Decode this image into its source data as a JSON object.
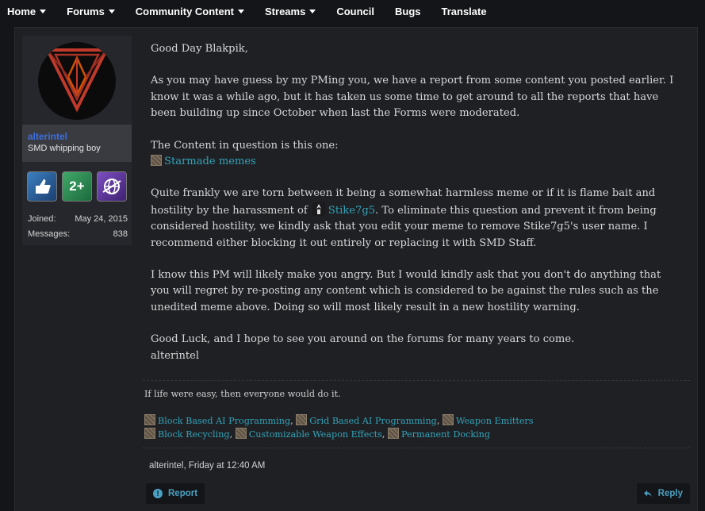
{
  "nav": {
    "items": [
      {
        "label": "Home",
        "dropdown": true
      },
      {
        "label": "Forums",
        "dropdown": true
      },
      {
        "label": "Community Content",
        "dropdown": true
      },
      {
        "label": "Streams",
        "dropdown": true
      },
      {
        "label": "Council",
        "dropdown": false
      },
      {
        "label": "Bugs",
        "dropdown": false
      },
      {
        "label": "Translate",
        "dropdown": false
      }
    ]
  },
  "user": {
    "name": "alterintel",
    "title": "SMD whipping boy",
    "joined_label": "Joined:",
    "joined_value": "May 24, 2015",
    "messages_label": "Messages:",
    "messages_value": "838",
    "trophy_2_text": "2+"
  },
  "message": {
    "greeting": "Good Day Blakpik,",
    "p1": "As you may have guess by my PMing you, we have a report from some content you posted earlier. I know it was a while ago, but it has taken us some time to get around to all the reports that have been building up since October when last the Forms were moderated.",
    "p2_intro": "The Content in question is this one:",
    "content_link": "Starmade memes",
    "p3_a": "Quite frankly we are torn between it being a somewhat harmless meme or if it is flame bait and hostility by the harassment of ",
    "mention": "Stike7g5",
    "p3_b": ". To eliminate this question and prevent it from being considered hostility, we kindly ask that you edit your meme to remove Stike7g5's user name. I recommend either blocking it out entirely or replacing it with SMD Staff.",
    "p4": "I know this PM will likely make you angry. But I would kindly ask that you don't do anything that you will regret by re-posting any content which is considered to be against the rules such as the unedited meme above. Doing so will most likely result in a new hostility warning.",
    "p5": "Good Luck, and I hope to see you around on the forums for many years to come.",
    "signoff": "alterintel"
  },
  "signature": {
    "quote": "If life were easy, then everyone would do it.",
    "links": [
      "Block Based AI Programming",
      "Grid Based AI Programming",
      "Weapon Emitters",
      "Block Recycling",
      "Customizable Weapon Effects",
      "Permanent Docking"
    ]
  },
  "meta": {
    "author_time": "alterintel, Friday at 12:40 AM"
  },
  "actions": {
    "report_label": "Report",
    "reply_label": "Reply"
  },
  "colors": {
    "link": "#32a3b8",
    "username": "#3b6ee0",
    "button_text": "#4aa0c0"
  }
}
